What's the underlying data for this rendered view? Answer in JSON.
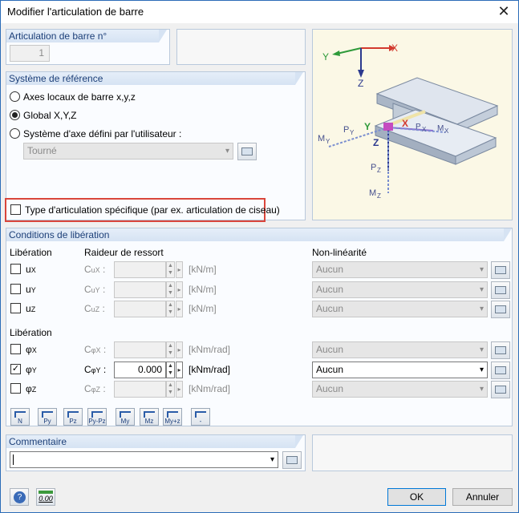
{
  "window": {
    "title": "Modifier l'articulation de barre"
  },
  "hinge_no": {
    "label": "Articulation de barre n°",
    "value": "1"
  },
  "reference_system": {
    "label": "Système de référence",
    "options": [
      "Axes locaux de barre x,y,z",
      "Global X,Y,Z",
      "Système d'axe défini par l'utilisateur :"
    ],
    "selected": "Global X,Y,Z",
    "user_axis_combo": "Tourné"
  },
  "specific_type": {
    "label": "Type d'articulation spécifique (par ex. articulation de ciseau)",
    "checked": false
  },
  "diagram": {
    "global_axes": {
      "x": "X",
      "y": "Y",
      "z": "Z"
    },
    "local_axes": {
      "x": "X",
      "y": "Y",
      "z": "Z"
    },
    "forces": {
      "px": "P",
      "px_sub": "X",
      "py": "P",
      "py_sub": "Y",
      "pz": "P",
      "pz_sub": "Z"
    },
    "moments": {
      "mx": "M",
      "mx_sub": "X",
      "my": "M",
      "my_sub": "Y",
      "mz": "M",
      "mz_sub": "Z"
    },
    "colors": {
      "x_axis": "#d23a2e",
      "y_axis": "#2e9a3a",
      "z_axis": "#2c3a8e",
      "member": "#b9c4d2"
    }
  },
  "release": {
    "label": "Conditions de libération",
    "col_release": "Libération",
    "col_spring": "Raideur de ressort",
    "col_nonlin": "Non-linéarité",
    "translation_rows": [
      {
        "symbol": "u",
        "sub": "X",
        "checked": false,
        "spring": "C",
        "spring_sub": "uX",
        "value": "",
        "unit": "[kN/m]",
        "nonlin": "Aucun"
      },
      {
        "symbol": "u",
        "sub": "Y",
        "checked": false,
        "spring": "C",
        "spring_sub": "uY",
        "value": "",
        "unit": "[kN/m]",
        "nonlin": "Aucun"
      },
      {
        "symbol": "u",
        "sub": "Z",
        "checked": false,
        "spring": "C",
        "spring_sub": "uZ",
        "value": "",
        "unit": "[kN/m]",
        "nonlin": "Aucun"
      }
    ],
    "col_release_rot": "Libération",
    "rotation_rows": [
      {
        "symbol": "φ",
        "sub": "X",
        "checked": false,
        "spring": "C",
        "spring_sub": "φX",
        "value": "",
        "unit": "[kNm/rad]",
        "nonlin": "Aucun",
        "active": false
      },
      {
        "symbol": "φ",
        "sub": "Y",
        "checked": true,
        "spring": "C",
        "spring_sub": "φY",
        "value": "0.000",
        "unit": "[kNm/rad]",
        "nonlin": "Aucun",
        "active": true
      },
      {
        "symbol": "φ",
        "sub": "Z",
        "checked": false,
        "spring": "C",
        "spring_sub": "φZ",
        "value": "",
        "unit": "[kNm/rad]",
        "nonlin": "Aucun",
        "active": false
      }
    ]
  },
  "toolbar": [
    "N",
    "Py",
    "Pz",
    "Py-Pz",
    "My",
    "Mz",
    "My+z",
    "-"
  ],
  "comment": {
    "label": "Commentaire",
    "value": ""
  },
  "bottom": {
    "ok": "OK",
    "cancel": "Annuler",
    "units_icon_text": "0.00"
  }
}
